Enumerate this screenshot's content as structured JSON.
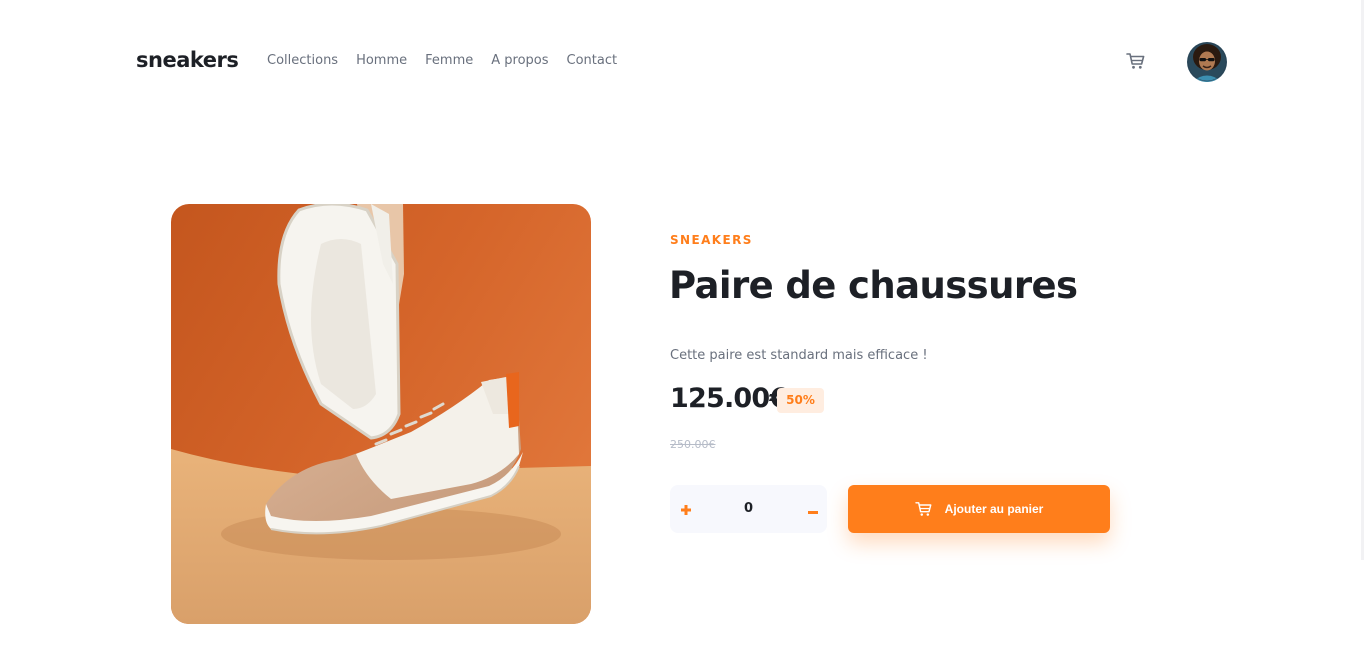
{
  "header": {
    "logo": "sneakers",
    "nav": [
      "Collections",
      "Homme",
      "Femme",
      "A propos",
      "Contact"
    ],
    "cart_icon": "cart-icon",
    "avatar_icon": "avatar"
  },
  "product": {
    "brand": "SNEAKERS",
    "title": "Paire de chaussures",
    "description": "Cette paire est standard mais efficace !",
    "price": "125.00€",
    "discount": "50%",
    "old_price": "250.00€",
    "image_icon": "sneaker-photo"
  },
  "quantity": {
    "value": "0",
    "plus_icon": "plus-icon",
    "minus_icon": "minus-icon"
  },
  "add_to_cart": {
    "label": "Ajouter au panier",
    "icon": "cart-icon"
  },
  "colors": {
    "accent": "#ff7e1b",
    "accent_pale": "#ffede0",
    "text_dark": "#1d2026",
    "text_muted": "#69707d",
    "text_light": "#b6bcc8",
    "surface": "#f7f8fd"
  }
}
